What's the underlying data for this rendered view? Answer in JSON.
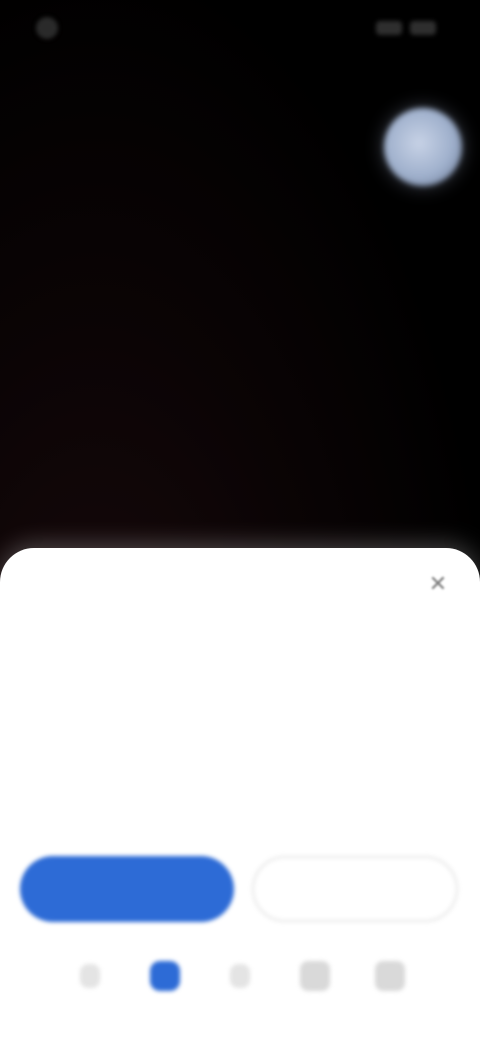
{
  "status_bar": {
    "time": "",
    "battery": ""
  },
  "profile": {
    "avatar_icon": "avatar-icon"
  },
  "sheet": {
    "close_icon": "close-icon",
    "close_glyph": "✕",
    "title": "",
    "body": "",
    "primary_button_label": "",
    "secondary_button_label": ""
  },
  "nav": {
    "items": [
      {
        "icon": "nav-icon-1"
      },
      {
        "icon": "nav-icon-2"
      },
      {
        "icon": "nav-icon-3"
      },
      {
        "icon": "nav-icon-4"
      },
      {
        "icon": "nav-icon-5"
      }
    ]
  },
  "colors": {
    "accent": "#2d6bd6",
    "sheet_background": "#ffffff",
    "screen_background": "#000000"
  }
}
